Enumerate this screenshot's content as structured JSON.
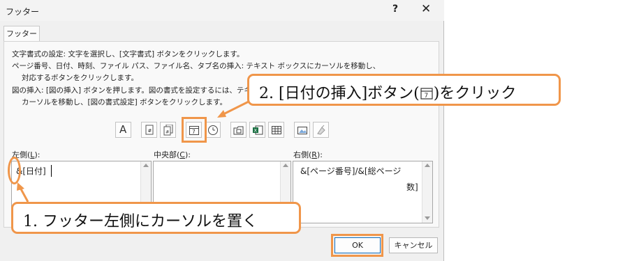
{
  "dialog": {
    "title": "フッター",
    "help_label": "?",
    "close_label": "✕",
    "tab_label": "フッター"
  },
  "instructions": {
    "line1": "文字書式の設定: 文字を選択し、[文字書式] ボタンをクリックします。",
    "line2": "ページ番号、日付、時刻、ファイル パス、ファイル名、タブ名の挿入: テキスト ボックスにカーソルを移動し、",
    "line3": "対応するボタンをクリックします。",
    "line4": "図の挿入: [図の挿入] ボタンを押します。図の書式を設定するには、テキスト",
    "line5": "カーソルを移動し、[図の書式設定] ボタンをクリックします。"
  },
  "toolbar": {
    "buttons": [
      "format-text",
      "insert-page-number",
      "insert-number-of-pages",
      "insert-date",
      "insert-time",
      "insert-file-path",
      "insert-file-name",
      "insert-sheet-name",
      "insert-picture",
      "format-picture"
    ]
  },
  "sections": {
    "left_label_main": "左側(",
    "left_label_key": "L",
    "left_label_end": "):",
    "left_value": "&[日付]",
    "center_label_main": "中央部(",
    "center_label_key": "C",
    "center_label_end": "):",
    "center_value": "",
    "right_label_main": "右側(",
    "right_label_key": "R",
    "right_label_end": "):",
    "right_value_line1": "&[ページ番号]/&[総ページ",
    "right_value_line2": "数]"
  },
  "buttons": {
    "ok": "OK",
    "cancel": "キャンセル"
  },
  "annotations": {
    "step2_text_before": "2. [日付の挿入]ボタン(",
    "step2_text_after": ")をクリック",
    "step1_text": "1. フッター左側にカーソルを置く",
    "accent_color": "#f0964a"
  }
}
